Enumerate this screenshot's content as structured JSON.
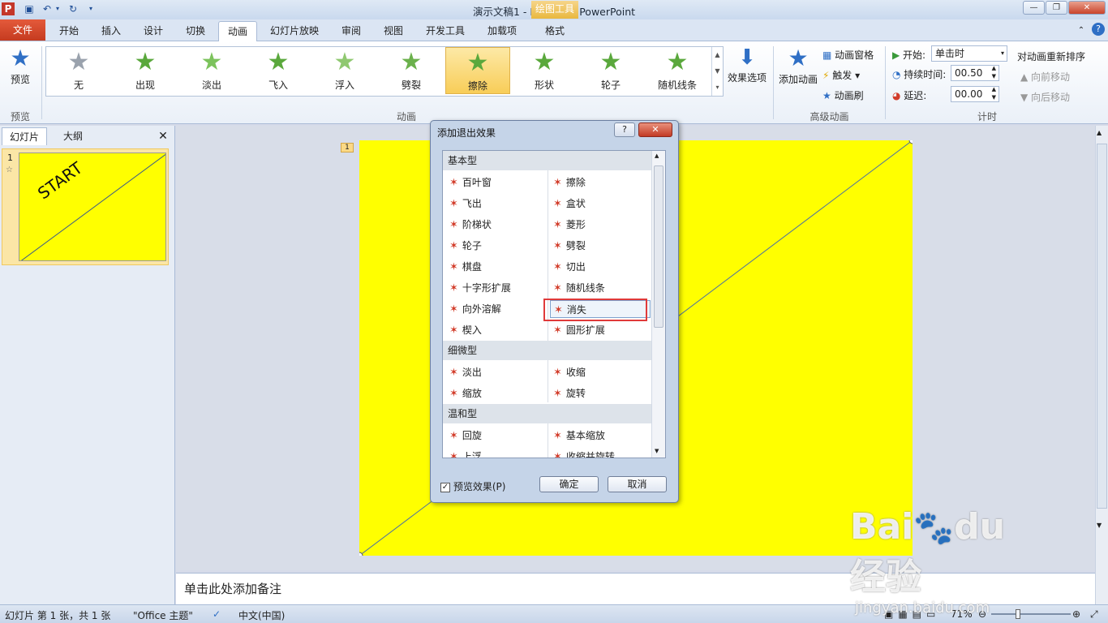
{
  "window": {
    "title": "演示文稿1 - Microsoft PowerPoint",
    "context_tools": "绘图工具"
  },
  "tabs": {
    "file": "文件",
    "items": [
      "开始",
      "插入",
      "设计",
      "切换",
      "动画",
      "幻灯片放映",
      "审阅",
      "视图",
      "开发工具",
      "加载项",
      "格式"
    ],
    "active": "动画"
  },
  "ribbon": {
    "preview": {
      "label": "预览",
      "group": "预览"
    },
    "animations": [
      "无",
      "出现",
      "淡出",
      "飞入",
      "浮入",
      "劈裂",
      "擦除",
      "形状",
      "轮子",
      "随机线条"
    ],
    "selected_animation": "擦除",
    "effect_options": "效果选项",
    "animation_group": "动画",
    "add_animation": "添加动画",
    "animation_pane": "动画窗格",
    "trigger": "触发",
    "animation_painter": "动画刷",
    "advanced_group": "高级动画",
    "start_label": "开始:",
    "start_value": "单击时",
    "duration_label": "持续时间:",
    "duration_value": "00.50",
    "delay_label": "延迟:",
    "delay_value": "00.00",
    "timing_group": "计时",
    "reorder_label": "对动画重新排序",
    "move_earlier": "向前移动",
    "move_later": "向后移动",
    "colors": {
      "accent_star": "#5aa83c",
      "selected_bg": "#f8cd58"
    }
  },
  "left_pane": {
    "tab_slides": "幻灯片",
    "tab_outline": "大纲",
    "slide_number": "1",
    "thumb_text": "START"
  },
  "slide": {
    "anim_tag": "1",
    "bg_color": "#ffff00"
  },
  "notes": {
    "placeholder": "单击此处添加备注"
  },
  "dialog": {
    "title": "添加退出效果",
    "categories": [
      {
        "name": "基本型",
        "effects": [
          "百叶窗",
          "擦除",
          "飞出",
          "盒状",
          "阶梯状",
          "菱形",
          "轮子",
          "劈裂",
          "棋盘",
          "切出",
          "十字形扩展",
          "随机线条",
          "向外溶解",
          "消失",
          "楔入",
          "圆形扩展"
        ]
      },
      {
        "name": "细微型",
        "effects": [
          "淡出",
          "收缩",
          "缩放",
          "旋转"
        ]
      },
      {
        "name": "温和型",
        "effects": [
          "回旋",
          "基本缩放",
          "上浮",
          "收缩并旋转"
        ]
      }
    ],
    "highlighted": "消失",
    "preview_checkbox": "预览效果(P)",
    "preview_checked": true,
    "ok": "确定",
    "cancel": "取消"
  },
  "status": {
    "slide_info": "幻灯片 第 1 张，共 1 张",
    "theme": "\"Office 主题\"",
    "language": "中文(中国)",
    "zoom": "71%"
  }
}
